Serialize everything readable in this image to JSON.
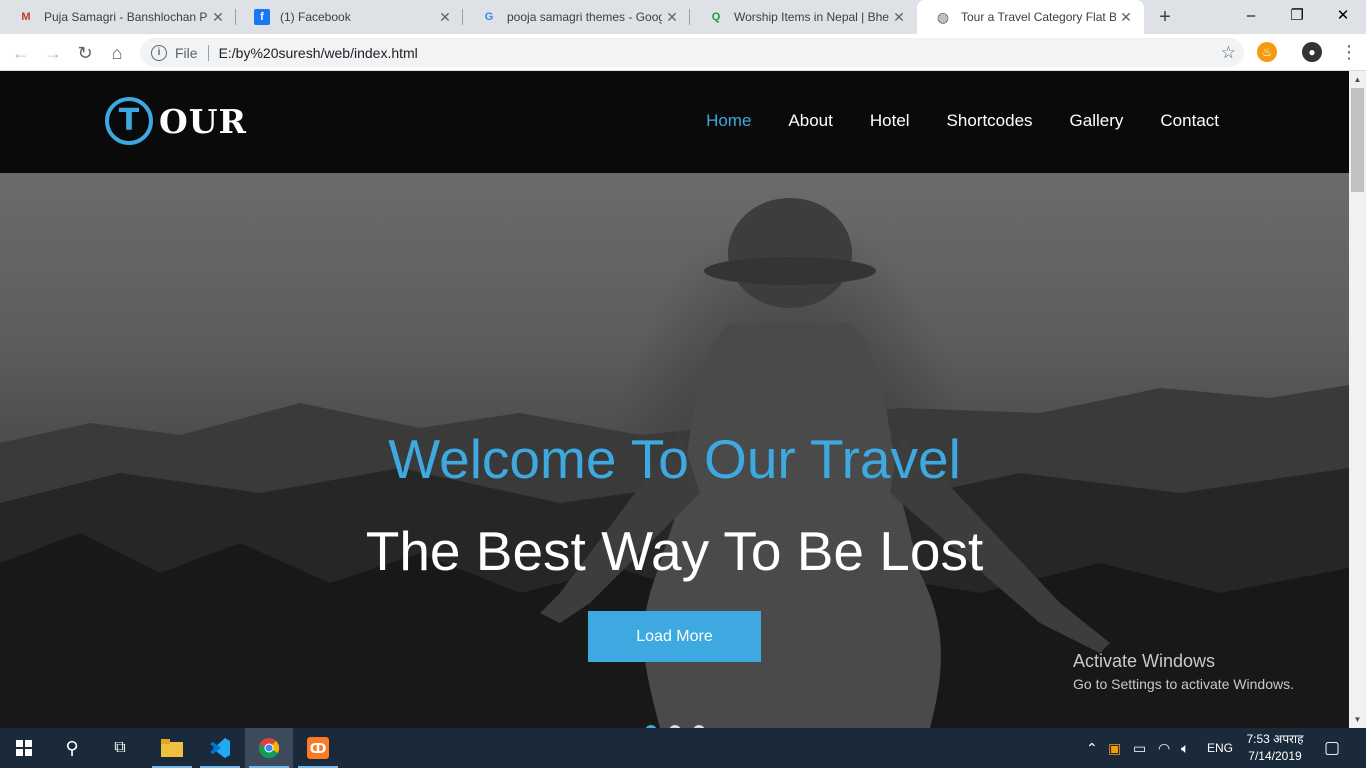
{
  "browser": {
    "tabs": [
      {
        "title": "Puja Samagri - Banshlochan Pu",
        "icon": "puja-favicon",
        "active": false
      },
      {
        "title": "(1) Facebook",
        "icon": "facebook-favicon",
        "active": false
      },
      {
        "title": "pooja samagri themes - Googl",
        "icon": "google-favicon",
        "active": false
      },
      {
        "title": "Worship Items in Nepal | Bheti",
        "icon": "q-favicon",
        "active": false
      },
      {
        "title": "Tour a Travel Category Flat Boo",
        "icon": "globe-favicon",
        "active": true
      }
    ],
    "address": {
      "scheme_label": "File",
      "url": "E:/by%20suresh/web/index.html"
    }
  },
  "site": {
    "logo": {
      "badge": "T",
      "word": "OUR"
    },
    "nav": [
      {
        "label": "Home",
        "current": true
      },
      {
        "label": "About",
        "current": false
      },
      {
        "label": "Hotel",
        "current": false
      },
      {
        "label": "Shortcodes",
        "current": false
      },
      {
        "label": "Gallery",
        "current": false
      },
      {
        "label": "Contact",
        "current": false
      }
    ],
    "hero": {
      "title": "Welcome To Our Travel",
      "subtitle": "The Best Way To Be Lost",
      "button": "Load More",
      "slides": 3,
      "active_slide": 1
    },
    "colors": {
      "accent": "#3ea9e0",
      "header_bg": "#0a0a0a"
    }
  },
  "watermark": {
    "line1": "Activate Windows",
    "line2": "Go to Settings to activate Windows."
  },
  "taskbar": {
    "lang": "ENG",
    "time": "7:53 अपराह",
    "date": "7/14/2019"
  }
}
